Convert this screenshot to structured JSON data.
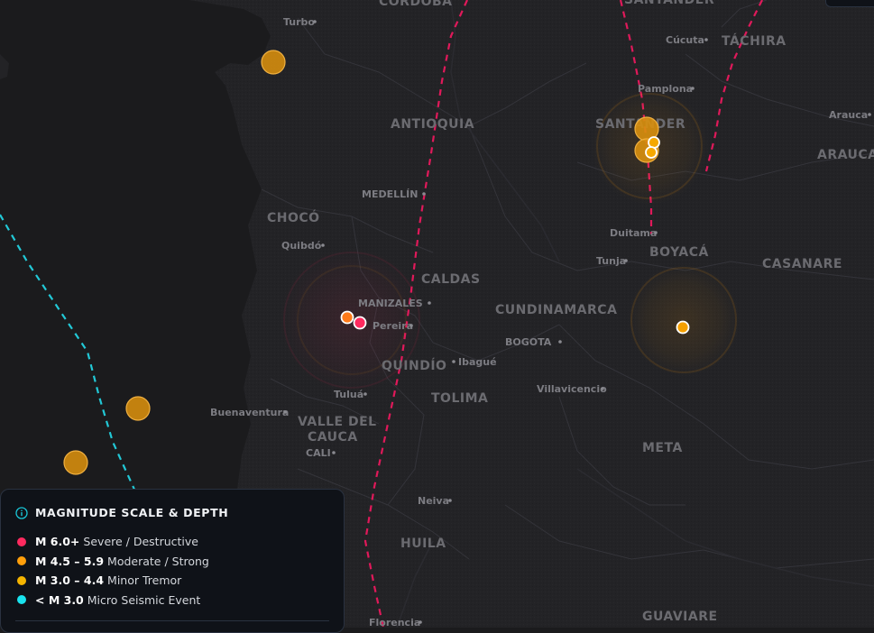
{
  "map": {
    "regions": [
      {
        "name": "CÓRDOBA",
        "key": "cordoba"
      },
      {
        "name": "SANTANDER",
        "key": "santander-top"
      },
      {
        "name": "TÁCHIRA",
        "key": "tachira"
      },
      {
        "name": "ANTIOQUIA",
        "key": "antioquia"
      },
      {
        "name": "SANTANDER",
        "key": "santander"
      },
      {
        "name": "ARAUCA",
        "key": "arauca"
      },
      {
        "name": "CHOCÓ",
        "key": "choco"
      },
      {
        "name": "BOYACÁ",
        "key": "boyaca"
      },
      {
        "name": "CASANARE",
        "key": "casanare"
      },
      {
        "name": "CALDAS",
        "key": "caldas"
      },
      {
        "name": "CUNDINAMARCA",
        "key": "cundinamarca"
      },
      {
        "name": "QUINDÍO",
        "key": "quindio"
      },
      {
        "name": "TOLIMA",
        "key": "tolima"
      },
      {
        "name": "VALLE DEL",
        "key": "valle1"
      },
      {
        "name": "CAUCA",
        "key": "valle2"
      },
      {
        "name": "META",
        "key": "meta"
      },
      {
        "name": "HUILA",
        "key": "huila"
      },
      {
        "name": "GUAVIARE",
        "key": "guaviare"
      }
    ],
    "cities": [
      {
        "name": "Turbo",
        "key": "turbo"
      },
      {
        "name": "Cúcuta",
        "key": "cucuta"
      },
      {
        "name": "Pamplona",
        "key": "pamplona"
      },
      {
        "name": "Arauca",
        "key": "arauca-city"
      },
      {
        "name": "MEDELLÍN",
        "key": "medellin"
      },
      {
        "name": "Quibdó",
        "key": "quibdo"
      },
      {
        "name": "Duitama",
        "key": "duitama"
      },
      {
        "name": "Tunja",
        "key": "tunja"
      },
      {
        "name": "MANIZALES",
        "key": "manizales"
      },
      {
        "name": "Pereira",
        "key": "pereira"
      },
      {
        "name": "BOGOTA",
        "key": "bogota"
      },
      {
        "name": "Ibagué",
        "key": "ibague"
      },
      {
        "name": "Villavicencio",
        "key": "villavicencio"
      },
      {
        "name": "Tuluá",
        "key": "tulua"
      },
      {
        "name": "Buenaventura",
        "key": "buenaventura"
      },
      {
        "name": "CALI",
        "key": "cali"
      },
      {
        "name": "Neiva",
        "key": "neiva"
      },
      {
        "name": "Florencia",
        "key": "florencia"
      }
    ],
    "events": [
      {
        "key": "quake-turbo",
        "class": "moderate"
      },
      {
        "key": "quake-pacific-1",
        "class": "moderate"
      },
      {
        "key": "quake-pacific-2",
        "class": "moderate"
      },
      {
        "key": "quake-santander-1",
        "class": "moderate"
      },
      {
        "key": "quake-santander-2",
        "class": "moderate"
      },
      {
        "key": "quake-santander-3",
        "class": "minor"
      },
      {
        "key": "quake-santander-4",
        "class": "minor"
      },
      {
        "key": "quake-meta",
        "class": "minor"
      },
      {
        "key": "quake-manizales-1",
        "class": "moderate"
      },
      {
        "key": "quake-manizales-2",
        "class": "severe"
      }
    ]
  },
  "legend": {
    "title": "MAGNITUDE SCALE & DEPTH",
    "items": [
      {
        "range": "M 6.0+",
        "label": "Severe / Destructive",
        "color": "#ff2a5f"
      },
      {
        "range": "M 4.5 – 5.9",
        "label": "Moderate / Strong",
        "color": "#ff9f0a"
      },
      {
        "range": "M 3.0 – 4.4",
        "label": "Minor Tremor",
        "color": "#f5b400"
      },
      {
        "range": "< M 3.0",
        "label": "Micro Seismic Event",
        "color": "#19e3ee"
      }
    ]
  },
  "colors": {
    "fault_line": "#e0195a",
    "trench_line": "#22c8d6",
    "land": "#232326",
    "sea": "#1b1b1d"
  }
}
